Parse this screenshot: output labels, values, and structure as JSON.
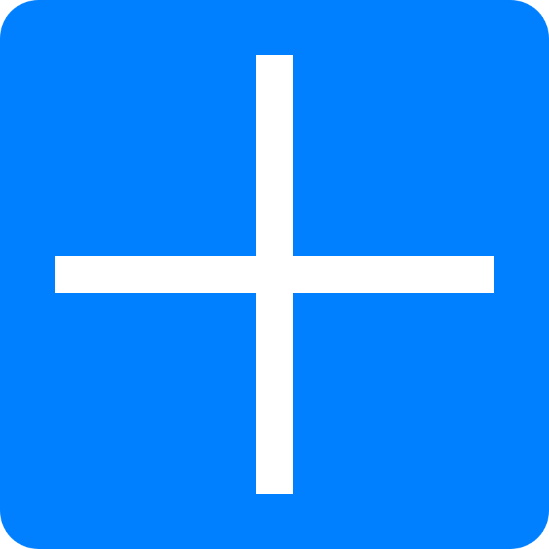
{
  "button": {
    "icon": "plus-icon",
    "background_color": "#0080ff",
    "icon_color": "#ffffff"
  }
}
